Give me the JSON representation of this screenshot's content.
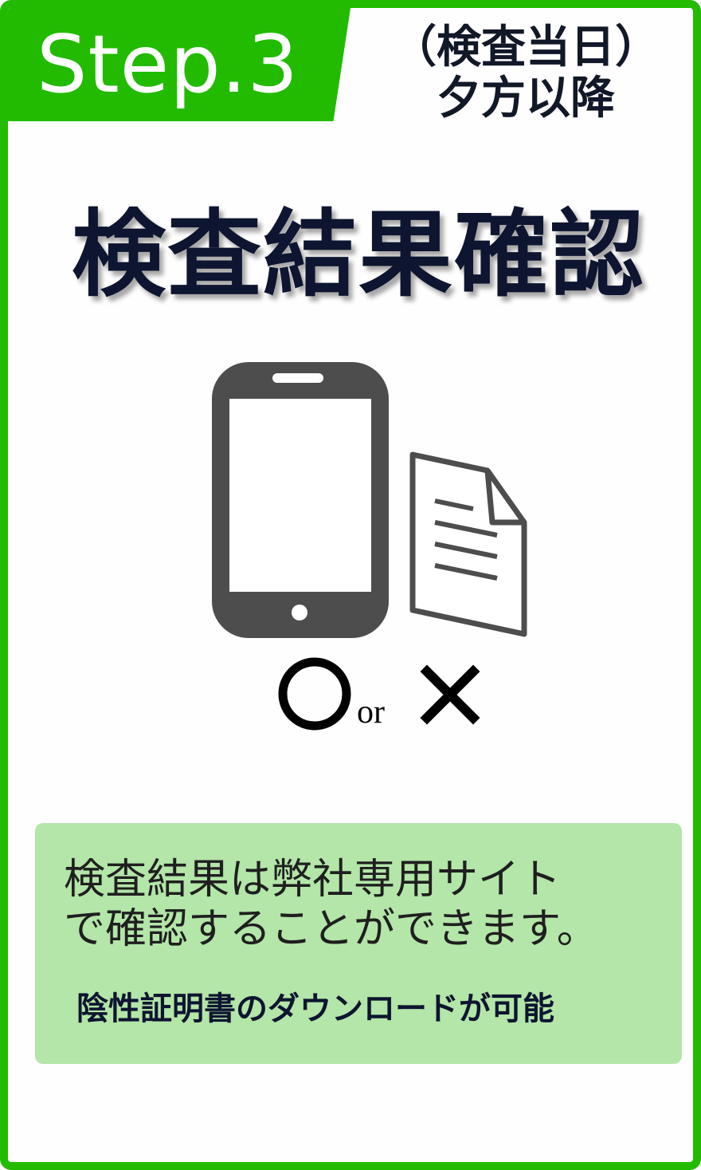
{
  "header": {
    "step_label": "Step.3",
    "timing_line1": "（検査当日）",
    "timing_line2": "夕方以降"
  },
  "main": {
    "title": "検査結果確認",
    "result_or": "or",
    "result_positive_icon": "circle-mark-icon",
    "result_negative_icon": "cross-mark-icon",
    "phone_icon": "smartphone-icon",
    "document_icon": "document-icon"
  },
  "info": {
    "line1": "検査結果は弊社専用サイト",
    "line2": "で確認することができます。",
    "note": "陰性証明書のダウンロードが可能"
  },
  "colors": {
    "accent_green": "#22bb00",
    "box_green": "#b3e6a8",
    "title_navy": "#0d1530",
    "icon_gray": "#4d4d4d"
  }
}
